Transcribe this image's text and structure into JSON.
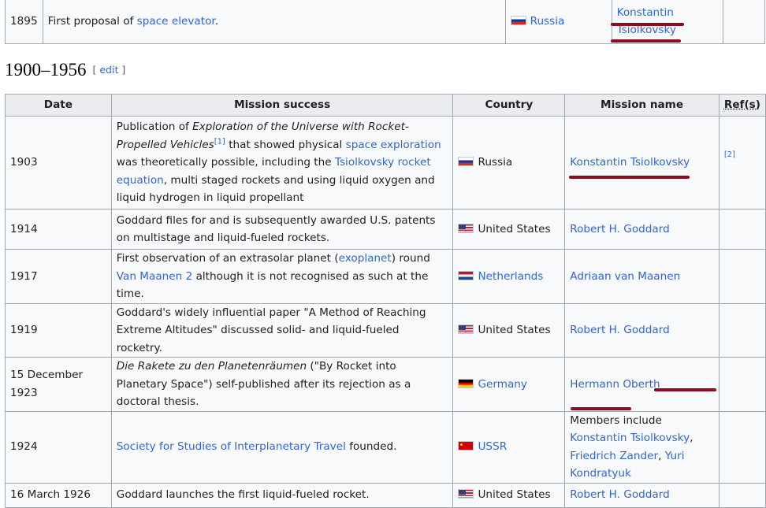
{
  "top_row": {
    "date": "1895",
    "mission_pre": "First proposal of ",
    "mission_link": "space elevator",
    "mission_post": ".",
    "country": "Russia",
    "country_flag": "flag-russia",
    "name_line1": "Konstantin",
    "name_line2": "Tsiolkovsky"
  },
  "section": {
    "title": "1900–1956",
    "edit_label": "edit",
    "lbr": "[ ",
    "rbr": " ]"
  },
  "headers": {
    "date": "Date",
    "mission": "Mission success",
    "country": "Country",
    "name": "Mission name",
    "refs": "Ref(s)"
  },
  "rows": {
    "r1903": {
      "date": "1903",
      "t1": "Publication of ",
      "i1": "Exploration of the Universe with Rocket-Propelled Vehicles",
      "sup": "[1]",
      "t2": " that showed physical ",
      "l1": "space exploration",
      "t3": " was theoretically possible, including the ",
      "l2": "Tsiolkovsky rocket equation",
      "t4": ", multi staged rockets and using liquid oxygen and liquid hydrogen in liquid propellant",
      "country": "Russia",
      "name": "Konstantin Tsiolkovsky",
      "ref": "[2]"
    },
    "r1914": {
      "date": "1914",
      "text": "Goddard files for and is subsequently awarded U.S. patents on multistage and liquid-fueled rockets.",
      "country": "United States",
      "name": "Robert H. Goddard"
    },
    "r1917": {
      "date": "1917",
      "t1": "First observation of an extrasolar planet (",
      "l1": "exoplanet",
      "t2": ") round ",
      "l2": "Van Maanen 2",
      "t3": " although it is not recognised as such at the time.",
      "country": "Netherlands",
      "name": "Adriaan van Maanen"
    },
    "r1919": {
      "date": "1919",
      "text": "Goddard's widely influential paper \"A Method of Reaching Extreme Altitudes\" discussed solid- and liquid-fueled rocketry.",
      "country": "United States",
      "name": "Robert H. Goddard"
    },
    "r1923": {
      "date": "15 December 1923",
      "i1": "Die Rakete zu den Planetenräumen",
      "t1": " (\"By Rocket into Planetary Space\") self-published after its rejection as a doctoral thesis.",
      "country": "Germany",
      "name": "Hermann Oberth"
    },
    "r1924": {
      "date": "1924",
      "l1": "Society for Studies of Interplanetary Travel",
      "t1": " founded.",
      "country": "USSR",
      "name_pre": "Members include ",
      "name_l1": "Konstantin Tsiolkovsky",
      "name_sep1": ", ",
      "name_l2": "Friedrich Zander",
      "name_sep2": ", ",
      "name_l3": "Yuri Kondratyuk"
    },
    "r1926": {
      "date": "16 March 1926",
      "text": "Goddard launches the first liquid-fueled rocket.",
      "country": "United States",
      "name": "Robert H. Goddard"
    }
  },
  "colors": {
    "link": "#3366cc",
    "annotation": "#8b0d1e",
    "border": "#a2a9b1",
    "header_bg": "#eaecf0"
  }
}
